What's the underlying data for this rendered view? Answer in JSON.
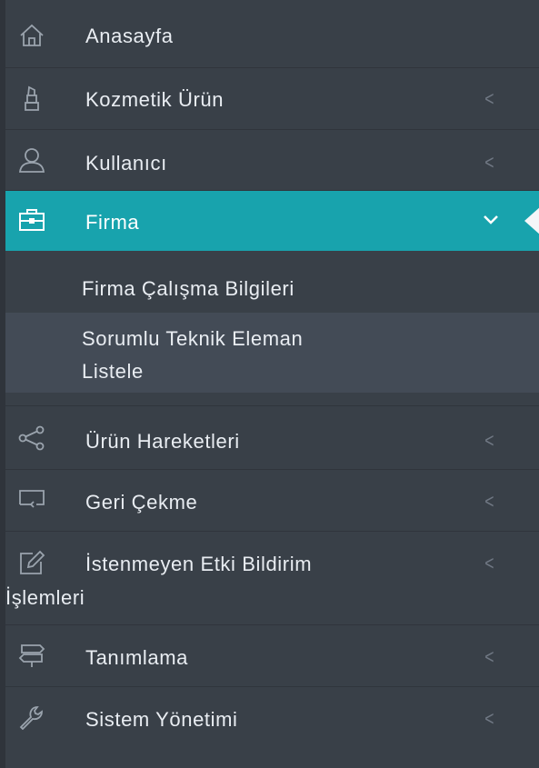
{
  "menu": {
    "items": [
      {
        "label": "Anasayfa",
        "icon": "home-icon"
      },
      {
        "label": "Kozmetik Ürün",
        "icon": "lipstick-icon",
        "chevron": "<"
      },
      {
        "label": "Kullanıcı",
        "icon": "user-icon",
        "chevron": "<"
      },
      {
        "label": "Firma",
        "icon": "briefcase-icon",
        "chevron": "⌄"
      },
      {
        "label": "Ürün Hareketleri",
        "icon": "share-icon",
        "chevron": "<"
      },
      {
        "label": "Geri Çekme",
        "icon": "return-icon",
        "chevron": "<"
      },
      {
        "label_line1": "İstenmeyen Etki Bildirim",
        "label_line2": "İşlemleri",
        "icon": "edit-icon",
        "chevron": "<"
      },
      {
        "label": "Tanımlama",
        "icon": "signpost-icon",
        "chevron": "<"
      },
      {
        "label": "Sistem Yönetimi",
        "icon": "wrench-icon",
        "chevron": "<"
      }
    ],
    "firma_submenu": [
      {
        "label": "Firma Çalışma Bilgileri"
      },
      {
        "label_line1": "Sorumlu Teknik Eleman",
        "label_line2": "Listele"
      }
    ]
  },
  "colors": {
    "sidebar_bg": "#394048",
    "active_bg": "#18a3ad",
    "selected_sub_bg": "#434b56",
    "text": "#e9edf2",
    "chevron": "#707884"
  }
}
